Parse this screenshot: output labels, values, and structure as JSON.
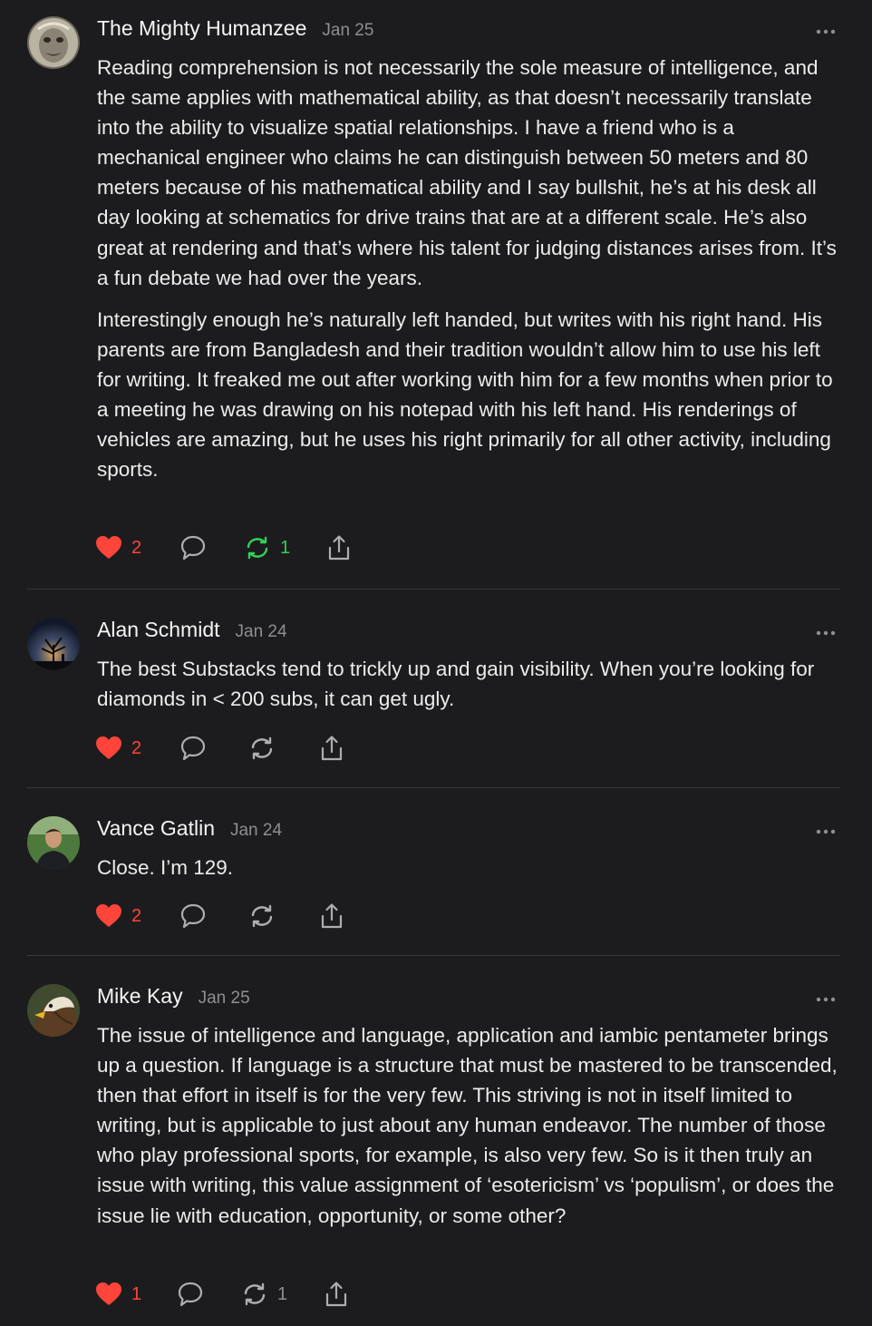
{
  "comments": [
    {
      "author": "The Mighty Humanzee",
      "date": "Jan 25",
      "paragraphs": [
        "Reading comprehension is not necessarily the sole measure of intelligence, and the same applies with mathematical ability, as that doesn’t necessarily translate into the ability to visualize spatial relationships. I have a friend who is a mechanical engineer who claims he can distinguish between 50 meters and 80 meters because of his mathematical ability and I say bullshit, he’s at his desk all day looking at schematics for drive trains that are at a different scale. He’s also great at rendering and that’s where his talent for judging distances arises from. It’s a fun debate we had over the years.",
        "Interestingly enough he’s naturally left handed, but writes with his right hand. His parents are from Bangladesh and their tradition wouldn’t allow him to use his left for writing. It freaked me out after working with him for a few months when prior to a meeting he was drawing on his notepad with his left hand. His renderings of vehicles are amazing, but he uses his right primarily for all other activity, including sports."
      ],
      "likes": "2",
      "restacks": "1",
      "restacked": true
    },
    {
      "author": "Alan Schmidt",
      "date": "Jan 24",
      "paragraphs": [
        "The best Substacks tend to trickly up and gain visibility. When you’re looking for diamonds in < 200 subs, it can get ugly."
      ],
      "likes": "2",
      "restacks": "",
      "restacked": false
    },
    {
      "author": "Vance Gatlin",
      "date": "Jan 24",
      "paragraphs": [
        "Close. I’m 129."
      ],
      "likes": "2",
      "restacks": "",
      "restacked": false
    },
    {
      "author": "Mike Kay",
      "date": "Jan 25",
      "paragraphs": [
        "The issue of intelligence and language, application and iambic pentameter brings up a question. If language is a structure that must be mastered to be transcended, then that effort in itself is for the very few. This striving is not in itself limited to writing, but is applicable to just about any human endeavor. The number of those who play professional sports, for example, is also very few. So is it then truly an issue with writing, this value assignment of ‘esotericism’ vs ‘populism’, or does the issue lie with education, opportunity, or some other?"
      ],
      "likes": "1",
      "restacks": "1",
      "restacked": false
    }
  ],
  "icons": {
    "like": "heart-icon",
    "reply": "speech-bubble-icon",
    "restack": "restack-arrows-icon",
    "share": "share-icon",
    "more": "ellipsis-icon"
  },
  "colors": {
    "background": "#1c1c1e",
    "like_red": "#ff453a",
    "restack_green": "#30d158",
    "muted": "#8e8e93"
  }
}
